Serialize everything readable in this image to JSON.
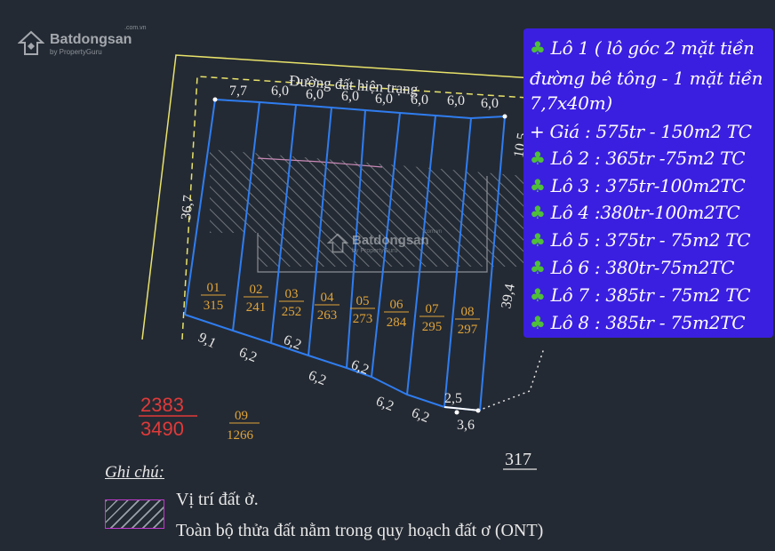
{
  "watermark": {
    "brand": "Batdongsan",
    "sub": "by PropertyGuru",
    "domain": ".com.vn"
  },
  "map": {
    "road_label": "Đường đất hiện trạng",
    "top_dims": [
      "7,7",
      "6,0",
      "6,0",
      "6,0",
      "6,0",
      "6,0",
      "6,0",
      "6,0"
    ],
    "left_side_dim": "36,7",
    "right_top_dim": "10,5",
    "right_side_dim": "39,4",
    "bottom_dims": [
      "9,1",
      "6,2",
      "6,2",
      "6,2",
      "6,2",
      "6,2",
      "6,2",
      "2,5",
      "3,6"
    ],
    "lots": [
      {
        "no": "01",
        "code": "315"
      },
      {
        "no": "02",
        "code": "241"
      },
      {
        "no": "03",
        "code": "252"
      },
      {
        "no": "04",
        "code": "263"
      },
      {
        "no": "05",
        "code": "273"
      },
      {
        "no": "06",
        "code": "284"
      },
      {
        "no": "07",
        "code": "295"
      },
      {
        "no": "08",
        "code": "297"
      }
    ],
    "parcel_09": {
      "no": "09",
      "code": "1266"
    },
    "red_parcel": {
      "top": "2383",
      "bottom": "3490"
    },
    "label_317": "317",
    "colors": {
      "background": "#242a33",
      "lot_lines": "#2f7df0",
      "road_line": "#e8e36a",
      "label_gold": "#e0a43a",
      "red": "#e03a3a",
      "hatch_border": "#c13ad0"
    }
  },
  "prices": {
    "lines": [
      "Lô 1 ( lô góc 2 mặt tiền",
      "đường bê tông - 1 mặt tiền",
      "7,7x40m)",
      "+ Giá : 575tr - 150m2 TC",
      "Lô 2 : 365tr -75m2 TC",
      "Lô 3 : 375tr-100m2TC",
      "Lô 4 :380tr-100m2TC",
      "Lô 5 : 375tr - 75m2 TC",
      "Lô 6 : 380tr-75m2TC",
      "Lô 7 : 385tr - 75m2 TC",
      "Lô 8 : 385tr - 75m2TC"
    ],
    "box_color": "#3b1fe0"
  },
  "legend": {
    "title": "Ghi chú:",
    "item1": "Vị trí đất ở.",
    "item2": "Toàn bộ thửa đất nằm trong quy hoạch đất ơ (ONT)"
  }
}
